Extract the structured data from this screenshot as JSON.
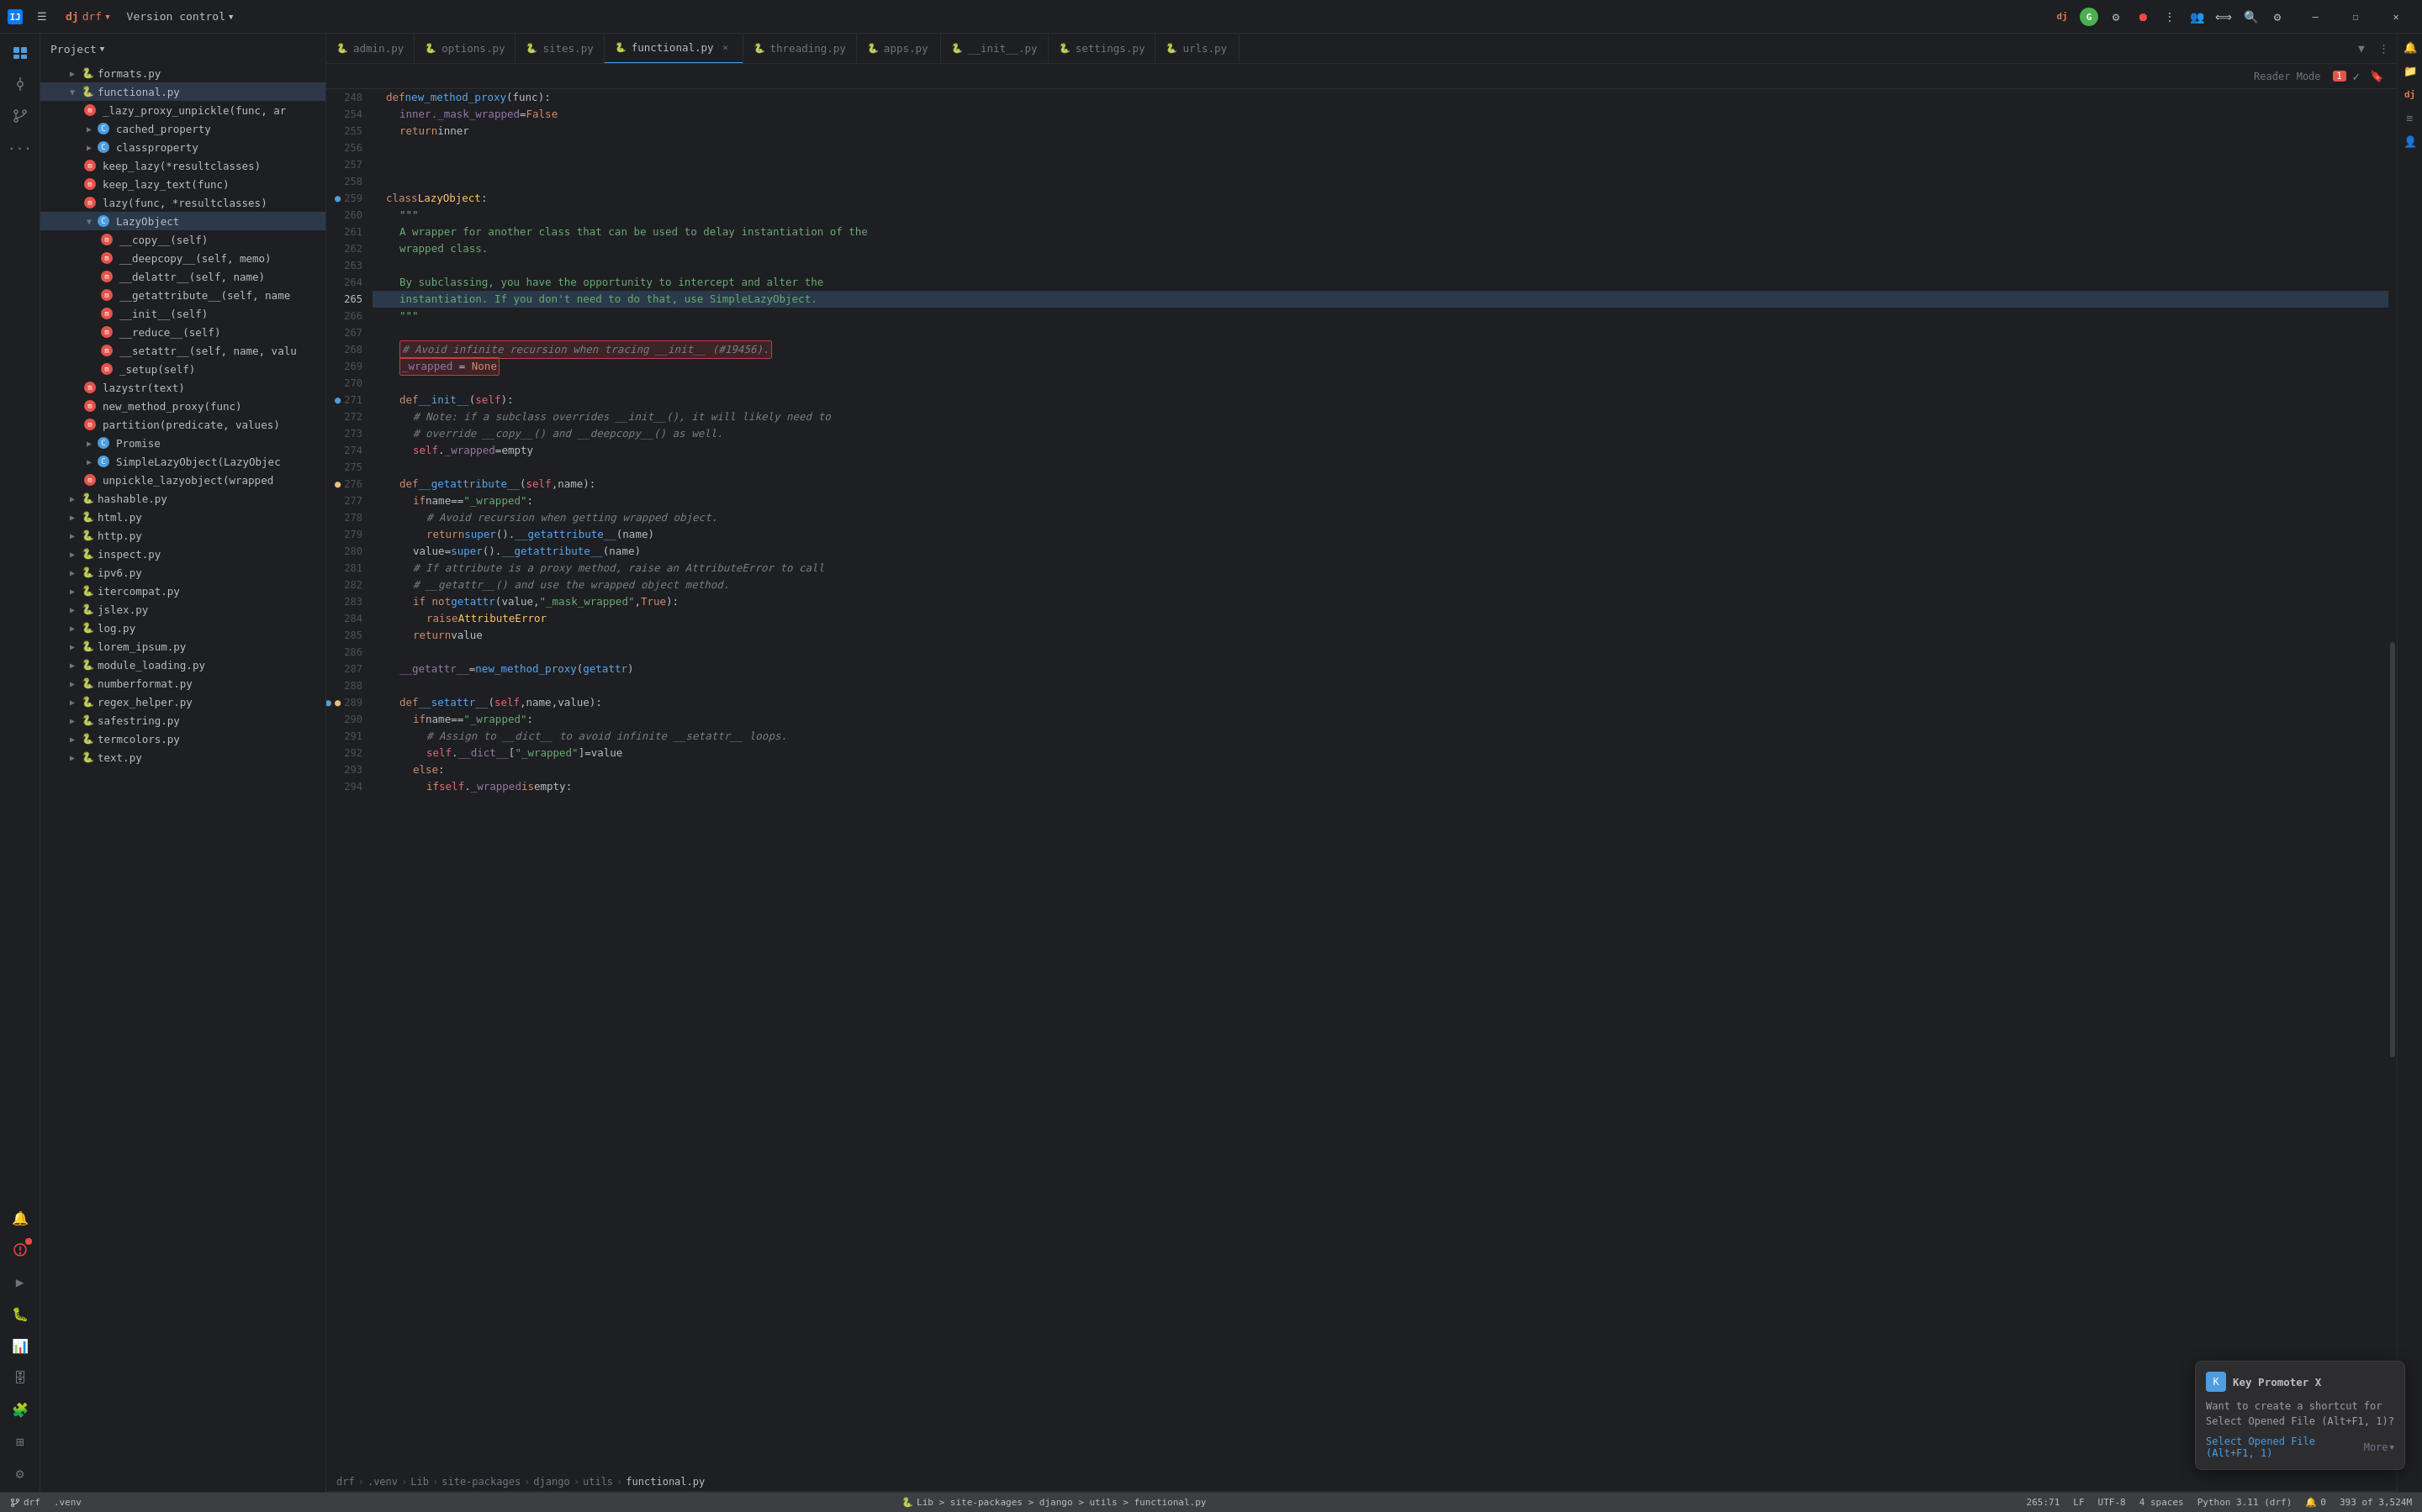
{
  "app": {
    "title": "drf",
    "version_control": "Version control",
    "project_label": "Project"
  },
  "title_bar": {
    "project_icon": "🟠",
    "menu_icon": "☰",
    "project_name": "drf",
    "version_control": "Version control",
    "drf_badge": "drf",
    "icons": [
      "ai-icon",
      "translate-icon",
      "search-icon",
      "settings-icon"
    ],
    "win_minimize": "—",
    "win_maximize": "☐",
    "win_close": "✕"
  },
  "tabs": [
    {
      "id": "admin",
      "label": "admin.py",
      "color": "#e06c75",
      "active": false
    },
    {
      "id": "options",
      "label": "options.py",
      "color": "#e06c75",
      "active": false
    },
    {
      "id": "sites",
      "label": "sites.py",
      "color": "#e06c75",
      "active": false
    },
    {
      "id": "functional",
      "label": "functional.py",
      "color": "#e06c75",
      "active": true
    },
    {
      "id": "threading",
      "label": "threading.py",
      "color": "#e06c75",
      "active": false
    },
    {
      "id": "apps",
      "label": "apps.py",
      "color": "#e06c75",
      "active": false
    },
    {
      "id": "__init__",
      "label": "__init__.py",
      "color": "#e06c75",
      "active": false
    },
    {
      "id": "settings",
      "label": "settings.py",
      "color": "#e06c75",
      "active": false
    },
    {
      "id": "urls",
      "label": "urls.py",
      "color": "#e06c75",
      "active": false
    }
  ],
  "sidebar": {
    "title": "Project",
    "items": [
      {
        "id": "formats",
        "label": "formats.py",
        "indent": 1,
        "type": "file",
        "icon": "🐍"
      },
      {
        "id": "functional",
        "label": "functional.py",
        "indent": 1,
        "type": "file-active",
        "icon": "🐍"
      },
      {
        "id": "lazy_proxy",
        "label": "_lazy_proxy_unpickle(func, ar",
        "indent": 2,
        "type": "method-red",
        "icon": "m"
      },
      {
        "id": "cached_property",
        "label": "cached_property",
        "indent": 2,
        "type": "class-blue",
        "icon": "C"
      },
      {
        "id": "classproperty",
        "label": "classproperty",
        "indent": 2,
        "type": "class-blue",
        "icon": "C"
      },
      {
        "id": "keep_lazy",
        "label": "keep_lazy(*resultclasses)",
        "indent": 2,
        "type": "method-red",
        "icon": "m"
      },
      {
        "id": "keep_lazy_text",
        "label": "keep_lazy_text(func)",
        "indent": 2,
        "type": "method-red",
        "icon": "m"
      },
      {
        "id": "lazy",
        "label": "lazy(func, *resultclasses)",
        "indent": 2,
        "type": "method-red",
        "icon": "m"
      },
      {
        "id": "LazyObject",
        "label": "LazyObject",
        "indent": 2,
        "type": "class-blue",
        "icon": "C",
        "expanded": true
      },
      {
        "id": "__copy__",
        "label": "__copy__(self)",
        "indent": 3,
        "type": "method-red",
        "icon": "m"
      },
      {
        "id": "__deepcopy__",
        "label": "__deepcopy__(self, memo)",
        "indent": 3,
        "type": "method-red",
        "icon": "m"
      },
      {
        "id": "__delattr__",
        "label": "__delattr__(self, name)",
        "indent": 3,
        "type": "method-red",
        "icon": "m"
      },
      {
        "id": "__getattribute__",
        "label": "__getattribute__(self, name",
        "indent": 3,
        "type": "method-red",
        "icon": "m"
      },
      {
        "id": "__init__",
        "label": "__init__(self)",
        "indent": 3,
        "type": "method-red",
        "icon": "m"
      },
      {
        "id": "__reduce__",
        "label": "__reduce__(self)",
        "indent": 3,
        "type": "method-red",
        "icon": "m"
      },
      {
        "id": "__setattr__",
        "label": "__setattr__(self, name, valu",
        "indent": 3,
        "type": "method-red",
        "icon": "m"
      },
      {
        "id": "_setup",
        "label": "_setup(self)",
        "indent": 3,
        "type": "method-red",
        "icon": "m"
      },
      {
        "id": "lazystr",
        "label": "lazystr(text)",
        "indent": 2,
        "type": "method-red",
        "icon": "m"
      },
      {
        "id": "new_method_proxy",
        "label": "new_method_proxy(func)",
        "indent": 2,
        "type": "method-red",
        "icon": "m"
      },
      {
        "id": "partition",
        "label": "partition(predicate, values)",
        "indent": 2,
        "type": "method-red",
        "icon": "m"
      },
      {
        "id": "Promise",
        "label": "Promise",
        "indent": 2,
        "type": "class-blue",
        "icon": "C"
      },
      {
        "id": "SimpleLazyObject",
        "label": "SimpleLazyObject(LazyObjec",
        "indent": 2,
        "type": "class-blue",
        "icon": "C"
      },
      {
        "id": "unpickle_lazyobject",
        "label": "unpickle_lazyobject(wrapped",
        "indent": 2,
        "type": "method-red",
        "icon": "m"
      },
      {
        "id": "hashable",
        "label": "hashable.py",
        "indent": 1,
        "type": "file",
        "icon": "🐍"
      },
      {
        "id": "html",
        "label": "html.py",
        "indent": 1,
        "type": "file",
        "icon": "🐍"
      },
      {
        "id": "http",
        "label": "http.py",
        "indent": 1,
        "type": "file",
        "icon": "🐍"
      },
      {
        "id": "inspect",
        "label": "inspect.py",
        "indent": 1,
        "type": "file",
        "icon": "🐍"
      },
      {
        "id": "ipv6",
        "label": "ipv6.py",
        "indent": 1,
        "type": "file",
        "icon": "🐍"
      },
      {
        "id": "itercompat",
        "label": "itercompat.py",
        "indent": 1,
        "type": "file",
        "icon": "🐍"
      },
      {
        "id": "jslex",
        "label": "jslex.py",
        "indent": 1,
        "type": "file",
        "icon": "🐍"
      },
      {
        "id": "log",
        "label": "log.py",
        "indent": 1,
        "type": "file",
        "icon": "🐍"
      },
      {
        "id": "lorem_ipsum",
        "label": "lorem_ipsum.py",
        "indent": 1,
        "type": "file",
        "icon": "🐍"
      },
      {
        "id": "module_loading",
        "label": "module_loading.py",
        "indent": 1,
        "type": "file",
        "icon": "🐍"
      },
      {
        "id": "numberformat",
        "label": "numberformat.py",
        "indent": 1,
        "type": "file",
        "icon": "🐍"
      },
      {
        "id": "regex_helper",
        "label": "regex_helper.py",
        "indent": 1,
        "type": "file",
        "icon": "🐍"
      },
      {
        "id": "safestring",
        "label": "safestring.py",
        "indent": 1,
        "type": "file",
        "icon": "🐍"
      },
      {
        "id": "termcolors",
        "label": "termcolors.py",
        "indent": 1,
        "type": "file",
        "icon": "🐍"
      },
      {
        "id": "text",
        "label": "text.py",
        "indent": 1,
        "type": "file",
        "icon": "🐍"
      }
    ]
  },
  "editor": {
    "filename": "functional.py",
    "reader_mode": "Reader Mode",
    "errors_count": "1",
    "lines": [
      {
        "num": 248,
        "content": "def new_method_proxy(func):",
        "type": "def"
      },
      {
        "num": 254,
        "content": "    inner._mask_wrapped = False",
        "type": "code"
      },
      {
        "num": 255,
        "content": "    return inner",
        "type": "code"
      },
      {
        "num": 256,
        "content": "",
        "type": "empty"
      },
      {
        "num": 257,
        "content": "",
        "type": "empty"
      },
      {
        "num": 258,
        "content": "",
        "type": "empty"
      },
      {
        "num": 259,
        "content": "class LazyObject:",
        "type": "class",
        "has_gutter": true
      },
      {
        "num": 260,
        "content": "    \"\"\"",
        "type": "string"
      },
      {
        "num": 261,
        "content": "    A wrapper for another class that can be used to delay instantiation of the",
        "type": "docstring"
      },
      {
        "num": 262,
        "content": "    wrapped class.",
        "type": "docstring"
      },
      {
        "num": 263,
        "content": "",
        "type": "empty"
      },
      {
        "num": 264,
        "content": "    By subclassing, you have the opportunity to intercept and alter the",
        "type": "docstring"
      },
      {
        "num": 265,
        "content": "    instantiation. If you don't need to do that, use SimpleLazyObject.",
        "type": "docstring"
      },
      {
        "num": 266,
        "content": "    \"\"\"",
        "type": "string"
      },
      {
        "num": 267,
        "content": "",
        "type": "empty"
      },
      {
        "num": 268,
        "content": "    # Avoid infinite recursion when tracing __init__ (#19456).",
        "type": "comment",
        "highlighted": true
      },
      {
        "num": 269,
        "content": "    _wrapped = None",
        "type": "code",
        "highlighted": true
      },
      {
        "num": 270,
        "content": "",
        "type": "empty"
      },
      {
        "num": 271,
        "content": "    def __init__(self):",
        "type": "def",
        "has_gutter": true
      },
      {
        "num": 272,
        "content": "        # Note: if a subclass overrides __init__(), it will likely need to",
        "type": "comment"
      },
      {
        "num": 273,
        "content": "        # override __copy__() and __deepcopy__() as well.",
        "type": "comment"
      },
      {
        "num": 274,
        "content": "        self._wrapped = empty",
        "type": "code"
      },
      {
        "num": 275,
        "content": "",
        "type": "empty"
      },
      {
        "num": 276,
        "content": "    def __getattribute__(self, name):",
        "type": "def",
        "has_gutter_yellow": true
      },
      {
        "num": 277,
        "content": "        if name == \"_wrapped\":",
        "type": "code"
      },
      {
        "num": 278,
        "content": "            # Avoid recursion when getting wrapped object.",
        "type": "comment"
      },
      {
        "num": 279,
        "content": "            return super().__getattribute__(name)",
        "type": "code"
      },
      {
        "num": 280,
        "content": "        value = super().__getattribute__(name)",
        "type": "code"
      },
      {
        "num": 281,
        "content": "        # If attribute is a proxy method, raise an AttributeError to call",
        "type": "comment"
      },
      {
        "num": 282,
        "content": "        # __getattr__() and use the wrapped object method.",
        "type": "comment"
      },
      {
        "num": 283,
        "content": "        if not getattr(value, \"_mask_wrapped\", True):",
        "type": "code"
      },
      {
        "num": 284,
        "content": "            raise AttributeError",
        "type": "code"
      },
      {
        "num": 285,
        "content": "        return value",
        "type": "code"
      },
      {
        "num": 286,
        "content": "",
        "type": "empty"
      },
      {
        "num": 287,
        "content": "    __getattr__ = new_method_proxy(getattr)",
        "type": "code"
      },
      {
        "num": 288,
        "content": "",
        "type": "empty"
      },
      {
        "num": 289,
        "content": "    def __setattr__(self, name, value):",
        "type": "def",
        "has_gutter_multi": true
      },
      {
        "num": 290,
        "content": "        if name == \"_wrapped\":",
        "type": "code"
      },
      {
        "num": 291,
        "content": "            # Assign to __dict__ to avoid infinite __setattr__ loops.",
        "type": "comment"
      },
      {
        "num": 292,
        "content": "            self.__dict__[\"_wrapped\"] = value",
        "type": "code"
      },
      {
        "num": 293,
        "content": "        else:",
        "type": "code"
      },
      {
        "num": 294,
        "content": "            if self._wrapped is empty:",
        "type": "code"
      }
    ]
  },
  "status_bar": {
    "git_branch": "drf",
    "venv": ".venv",
    "lib_path": "Lib > site-packages > django > utils > functional.py",
    "line_col": "265:71",
    "encoding": "UTF-8",
    "line_ending": "LF",
    "indent": "4 spaces",
    "python": "Python 3.11 (drf)",
    "notifications": "0",
    "memory": "393 of 3,524M"
  },
  "key_promoter": {
    "title": "Key Promoter X",
    "body": "Want to create a shortcut for Select Opened File (Alt+F1, 1)?",
    "link": "Select Opened File (Alt+F1, 1)",
    "more": "More"
  },
  "breadcrumb": {
    "items": [
      "drf",
      ".venv",
      "Lib",
      "site-packages",
      "django",
      "utils",
      "functional.py"
    ]
  }
}
